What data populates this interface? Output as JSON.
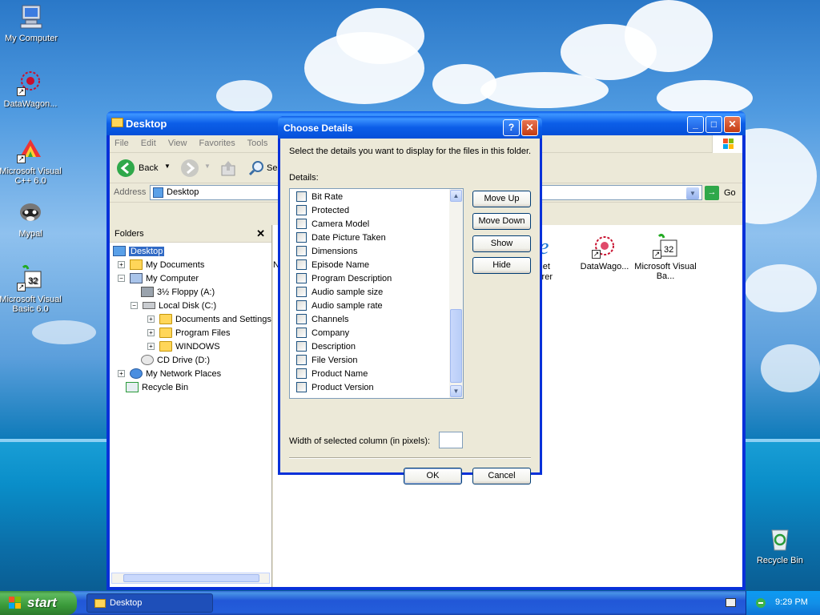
{
  "desktop": {
    "icons": [
      {
        "label": "My Computer",
        "icon": "my-computer-icon"
      },
      {
        "label": "DataWagon...",
        "icon": "datawagon-icon"
      },
      {
        "label": "Microsoft Visual C++ 6.0",
        "icon": "visual-cpp-icon"
      },
      {
        "label": "Mypal",
        "icon": "mypal-icon"
      },
      {
        "label": "Microsoft Visual Basic 6.0",
        "icon": "visual-basic-icon"
      },
      {
        "label": "Recycle Bin",
        "icon": "recycle-bin-icon"
      }
    ]
  },
  "explorer": {
    "title": "Desktop",
    "menu": [
      "File",
      "Edit",
      "View",
      "Favorites",
      "Tools"
    ],
    "toolbar": {
      "back_label": "Back",
      "search_label": "Se"
    },
    "address": {
      "label": "Address",
      "value": "Desktop",
      "go_label": "Go"
    },
    "folders": {
      "title": "Folders",
      "close_glyph": "✕",
      "tree": [
        {
          "label": "Desktop",
          "expander": "",
          "selected": true
        },
        {
          "label": "My Documents",
          "expander": "+"
        },
        {
          "label": "My Computer",
          "expander": "−"
        },
        {
          "label": "3½ Floppy (A:)",
          "expander": ""
        },
        {
          "label": "Local Disk (C:)",
          "expander": "−"
        },
        {
          "label": "Documents and Settings",
          "expander": "+"
        },
        {
          "label": "Program Files",
          "expander": "+"
        },
        {
          "label": "WINDOWS",
          "expander": "+"
        },
        {
          "label": "CD Drive (D:)",
          "expander": ""
        },
        {
          "label": "My Network Places",
          "expander": "+"
        },
        {
          "label": "Recycle Bin",
          "expander": ""
        }
      ]
    },
    "content_icons": [
      {
        "label": "rnet\nlorer",
        "icon": "internet-explorer-icon"
      },
      {
        "label": "DataWago...",
        "icon": "datawagon-icon"
      },
      {
        "label": "Microsoft Visual Ba...",
        "icon": "visual-basic-icon"
      }
    ],
    "partial_letter": "N"
  },
  "dialog": {
    "title": "Choose Details",
    "help_glyph": "?",
    "close_glyph": "✕",
    "instruction": "Select the details you want to display for the files in this folder.",
    "details_label": "Details:",
    "details": [
      {
        "label": "Bit Rate",
        "checked": false
      },
      {
        "label": "Protected",
        "checked": false
      },
      {
        "label": "Camera Model",
        "checked": false
      },
      {
        "label": "Date Picture Taken",
        "checked": false
      },
      {
        "label": "Dimensions",
        "checked": false
      },
      {
        "label": "Episode Name",
        "checked": false
      },
      {
        "label": "Program Description",
        "checked": false
      },
      {
        "label": "Audio sample size",
        "checked": false
      },
      {
        "label": "Audio sample rate",
        "checked": false
      },
      {
        "label": "Channels",
        "checked": false
      },
      {
        "label": "Company",
        "checked": false
      },
      {
        "label": "Description",
        "checked": false
      },
      {
        "label": "File Version",
        "checked": false
      },
      {
        "label": "Product Name",
        "checked": false
      },
      {
        "label": "Product Version",
        "checked": false
      }
    ],
    "buttons": {
      "move_up": "Move Up",
      "move_down": "Move Down",
      "show": "Show",
      "hide": "Hide",
      "ok": "OK",
      "cancel": "Cancel"
    },
    "width_label": "Width of selected column (in pixels):",
    "width_value": ""
  },
  "taskbar": {
    "start_label": "start",
    "task_label": "Desktop",
    "clock": "9:29 PM"
  }
}
